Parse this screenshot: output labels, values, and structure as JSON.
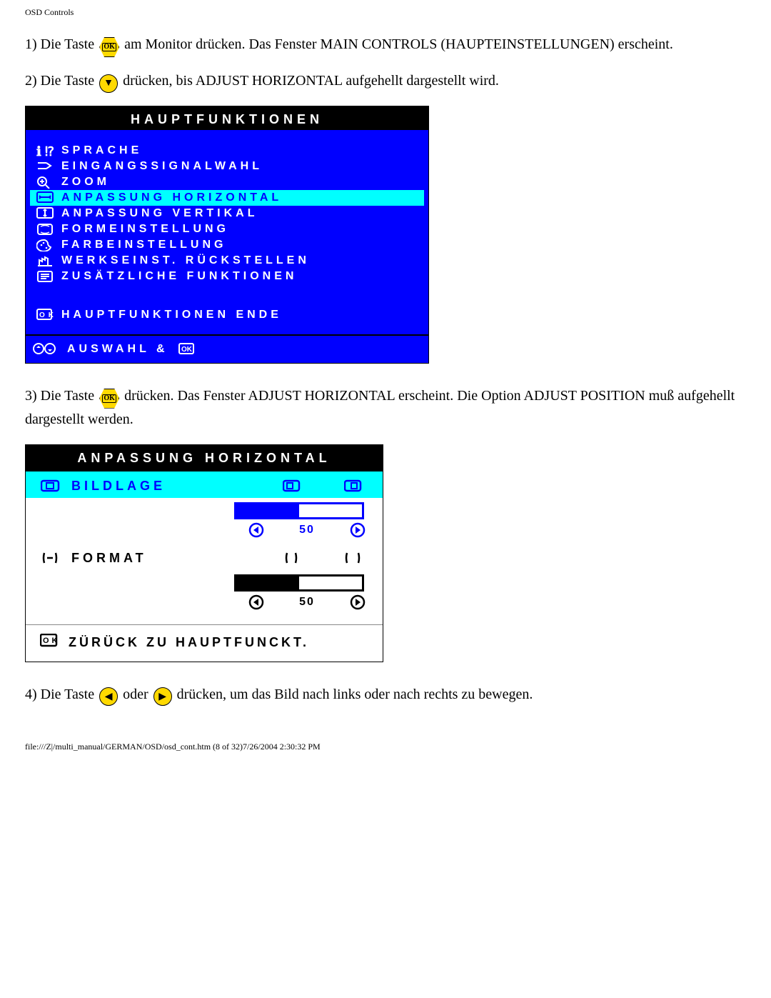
{
  "header": "OSD Controls",
  "step1_a": "1) Die Taste ",
  "step1_b": " am Monitor drücken. Das Fenster MAIN CONTROLS (HAUPTEINSTELLUNGEN) erscheint.",
  "step2_a": "2) Die Taste ",
  "step2_b": " drücken, bis ADJUST HORIZONTAL aufgehellt dargestellt wird.",
  "step3_a": "3) Die Taste ",
  "step3_b": " drücken. Das Fenster ADJUST HORIZONTAL erscheint. Die Option ADJUST POSITION muß aufgehellt dargestellt werden.",
  "step4_a": "4) Die Taste ",
  "step4_b": " oder ",
  "step4_c": " drücken, um das Bild nach links oder nach rechts zu bewegen.",
  "osd1": {
    "title": "HAUPTFUNKTIONEN",
    "items": [
      {
        "icon": "globe-question",
        "label": "SPRACHE",
        "hl": false
      },
      {
        "icon": "input-arrow",
        "label": "EINGANGSSIGNALWAHL",
        "hl": false
      },
      {
        "icon": "magnify-plus",
        "label": "ZOOM",
        "hl": false
      },
      {
        "icon": "h-arrows",
        "label": "ANPASSUNG HORIZONTAL",
        "hl": true
      },
      {
        "icon": "v-arrows",
        "label": "ANPASSUNG VERTIKAL",
        "hl": false
      },
      {
        "icon": "screen-shape",
        "label": "FORMEINSTELLUNG",
        "hl": false
      },
      {
        "icon": "palette",
        "label": "FARBEINSTELLUNG",
        "hl": false
      },
      {
        "icon": "factory",
        "label": "WERKSEINST. RÜCKSTELLEN",
        "hl": false
      },
      {
        "icon": "list-box",
        "label": "ZUSÄTZLICHE FUNKTIONEN",
        "hl": false
      }
    ],
    "exit_label": "HAUPTFUNKTIONEN ENDE",
    "footer_label": "AUSWAHL &"
  },
  "osd2": {
    "title": "ANPASSUNG HORIZONTAL",
    "s1_label": "BILDLAGE",
    "s1_value": "50",
    "s2_label": "FORMAT",
    "s2_value": "50",
    "back_label": "ZÜRÜCK ZU HAUPTFUNCKT."
  },
  "footer_path": "file:///Z|/multi_manual/GERMAN/OSD/osd_cont.htm (8 of 32)7/26/2004 2:30:32 PM",
  "icons": {
    "ok_label": "OK"
  }
}
